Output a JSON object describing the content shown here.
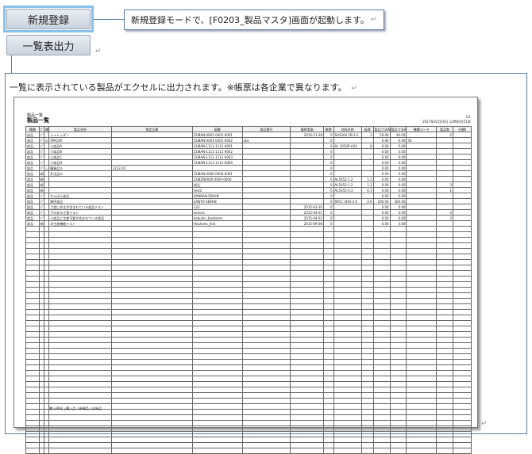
{
  "buttons": {
    "new_register": "新規登録",
    "list_output": "一覧表出力"
  },
  "callout_text": "新規登録モードで、[F0203_製品マスタ]画面が起動します。",
  "para_mark": "↵",
  "description": "一覧に表示されている製品がエクセルに出力されます。※帳票は各企業で異なります。",
  "sheet": {
    "title": "製品一覧",
    "subtitle": "製品一覧",
    "page": "1/1",
    "printed": "2017年02月16日 12時40分51秒",
    "headers": [
      "種類",
      "ｸﾞ",
      "種",
      "製品名称",
      "指定品番",
      "図番",
      "部品番号",
      "最終実施",
      "数数",
      "材料名称",
      "板厚",
      "製品寸法W",
      "製品寸法H",
      "機種コード",
      "製品数",
      "分類Ⅱ"
    ],
    "rows": [
      [
        "部品",
        "ｸﾞ",
        "",
        "シュレッダー",
        "",
        "ZUBAN-0001-0001-0001",
        "",
        "2016-11-28",
        "0",
        "SUS304 2B-2.0",
        "2",
        "50.00",
        "40.00",
        "",
        "2",
        ""
      ],
      [
        "部品",
        "ｸﾞ",
        "◎",
        "SPACER",
        "",
        "ZUBAN-0001-0001-0002",
        "abc",
        "",
        "0",
        "",
        "",
        "0.00",
        "0.00",
        "40",
        "",
        ""
      ],
      [
        "部品",
        "ｸﾞ",
        "",
        "小部品A",
        "",
        "ZUBAN-1111-1111-0001",
        "",
        "",
        "0",
        "AL 1050P-H24",
        "8",
        "0.00",
        "0.00",
        "",
        "",
        ""
      ],
      [
        "部品",
        "ｸﾞ",
        "",
        "小部品B",
        "",
        "ZUBAN-1111-1111-0002",
        "",
        "",
        "0",
        "",
        "",
        "0.00",
        "0.00",
        "",
        "",
        ""
      ],
      [
        "部品",
        "ｸﾞ",
        "",
        "小部品C",
        "",
        "ZUBAN-1111-1111-0003",
        "",
        "",
        "0",
        "",
        "",
        "0.00",
        "0.00",
        "",
        "",
        ""
      ],
      [
        "部品",
        "ｸﾞ",
        "",
        "小部品D",
        "",
        "ZUBAN-1111-1111-0004",
        "",
        "",
        "0",
        "",
        "",
        "0.00",
        "0.00",
        "",
        "",
        ""
      ],
      [
        "部品",
        "ｸﾞ",
        "△",
        "購買品①",
        "2222-01",
        "",
        "",
        "",
        "0",
        "",
        "",
        "0.00",
        "0.00",
        "",
        "",
        ""
      ],
      [
        "部品",
        "新",
        "",
        "外注品①",
        "",
        "ZUBAN-0000-0000-0001",
        "",
        "",
        "0",
        "",
        "",
        "0.00",
        "0.00",
        "",
        "",
        ""
      ],
      [
        "部品",
        "新",
        "",
        "",
        "",
        "ZUBZN0000-0000-0000",
        "",
        "",
        "0",
        "AL5052-1.2",
        "1.2",
        "0.00",
        "0.00",
        "",
        "",
        ""
      ],
      [
        "部品",
        "新",
        "",
        "",
        "",
        "部品",
        "",
        "",
        "0",
        "AL5052-1.2",
        "1.2",
        "0.00",
        "0.00",
        "",
        "3",
        ""
      ],
      [
        "部品",
        "新",
        "",
        "",
        "",
        "test2",
        "",
        "",
        "0",
        "AL5052-0.3",
        "0.3",
        "0.00",
        "0.00",
        "",
        "1",
        ""
      ],
      [
        "部品",
        "ｸﾞ",
        "",
        "かんばん部品",
        "",
        "KANBAN-SEIHIN",
        "",
        "",
        "0",
        "",
        "",
        "0.00",
        "0.00",
        "",
        "",
        ""
      ],
      [
        "部品",
        "ｸﾞ",
        "",
        "順序部品",
        "",
        "JUNJYO-SEIHIN",
        "",
        "",
        "0",
        "SPCC 3HO-2.6",
        "2.6",
        "200.00",
        "300.00",
        "",
        "",
        ""
      ],
      [
        "部品",
        "ｸﾞ",
        "",
        "工程に外注が含まれている部品テスト",
        "",
        "123",
        "",
        "2015-03-30",
        "0",
        "",
        "",
        "0.00",
        "0.00",
        "",
        "",
        ""
      ],
      [
        "部品",
        "ｸﾞ",
        "",
        "子のある工程テスト",
        "",
        "kenora",
        "",
        "2015-04-01",
        "0",
        "",
        "",
        "0.00",
        "0.00",
        "",
        "4",
        ""
      ],
      [
        "部品",
        "ｸﾞ",
        "",
        "小部品に生産不要が含まれている部品",
        "",
        "kobuhin_banbamn",
        "",
        "2015-04-02",
        "0",
        "",
        "",
        "0.00",
        "0.00",
        "",
        "2",
        ""
      ],
      [
        "部品",
        "新",
        "",
        "木生産機能テスト",
        "",
        "Houtisen_test",
        "",
        "2015-09-08",
        "0",
        "",
        "",
        "0.00",
        "0.00",
        "",
        "",
        ""
      ]
    ],
    "legend": "種 ◎寄材 △購入品 ○新規品 ◇支給品"
  }
}
